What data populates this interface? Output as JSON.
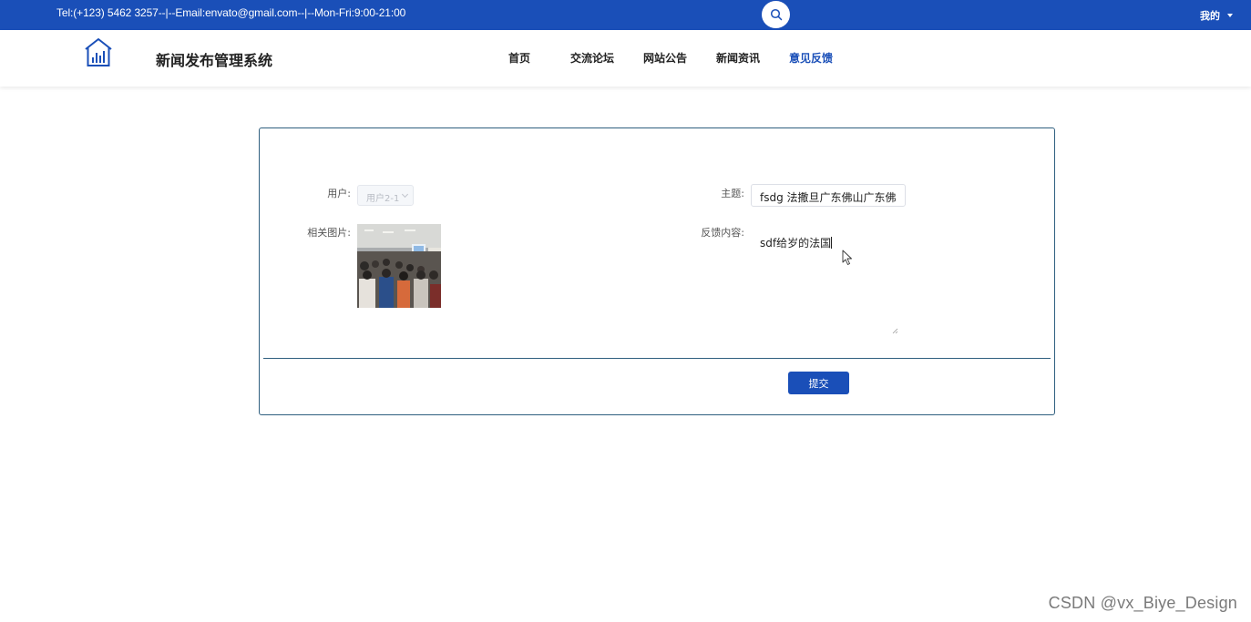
{
  "topbar": {
    "contact": "Tel:(+123) 5462 3257--|--Email:envato@gmail.com--|--Mon-Fri:9:00-21:00",
    "user_menu_label": "我的",
    "color": "#1a4fb8"
  },
  "header": {
    "site_title": "新闻发布管理系统",
    "logo_icon": "house-chart-icon"
  },
  "nav": {
    "items": [
      {
        "label": "首页"
      },
      {
        "label": "交流论坛"
      },
      {
        "label": "网站公告"
      },
      {
        "label": "新闻资讯"
      },
      {
        "label": "意见反馈"
      }
    ],
    "active_index": 4
  },
  "form": {
    "user_label": "用户:",
    "user_value": "用户2-1",
    "image_label": "相关图片:",
    "subject_label": "主题:",
    "subject_value": "fsdg 法撒旦广东佛山广东佛",
    "content_label": "反馈内容:",
    "content_value": "sdf给岁的法国",
    "submit_label": "提交"
  },
  "watermark": "CSDN @vx_Biye_Design"
}
